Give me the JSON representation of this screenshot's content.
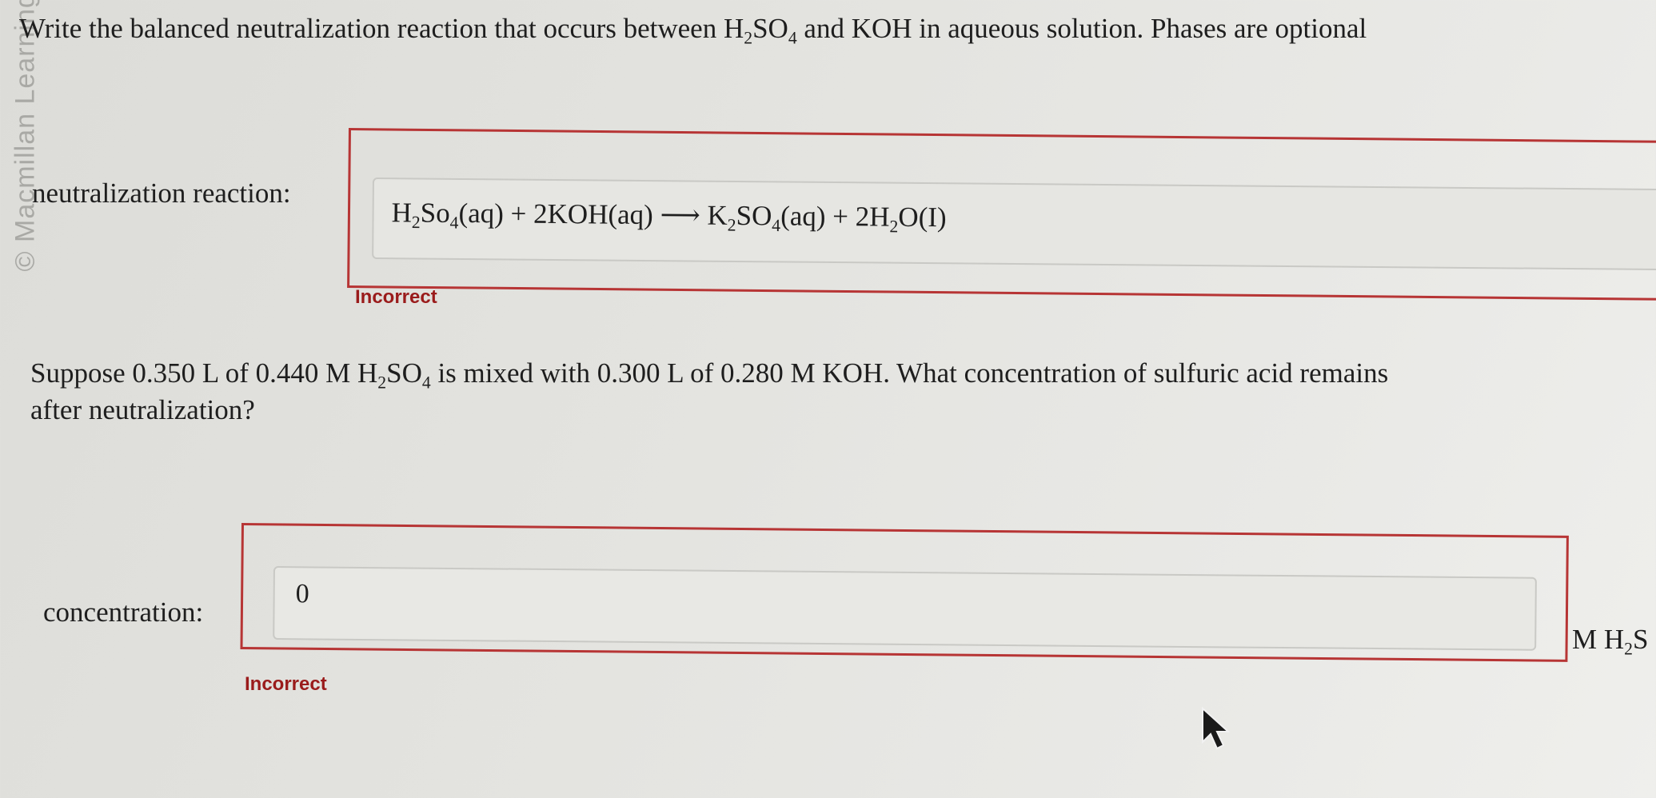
{
  "watermark": "© Macmillan Learning",
  "question1": {
    "text_before": "Write the balanced neutralization reaction that occurs between ",
    "acid_main": "H",
    "acid_sub1": "2",
    "acid_mid": "SO",
    "acid_sub2": "4",
    "text_after": " and KOH in aqueous solution. Phases are optional"
  },
  "reaction": {
    "label": "neutralization reaction:",
    "p1": "H",
    "s1": "2",
    "p2": "So",
    "s2": "4",
    "p3": "(aq) + 2KOH(aq) ⟶ K",
    "s3": "2",
    "p4": "SO",
    "s4": "4",
    "p5": "(aq) + 2H",
    "s5": "2",
    "p6": "O(I)",
    "feedback": "Incorrect"
  },
  "question2": {
    "line1_a": "Suppose 0.350 L of 0.440 M H",
    "line1_sub1": "2",
    "line1_b": "SO",
    "line1_sub2": "4",
    "line1_c": " is mixed with 0.300 L of 0.280 M KOH. What concentration of sulfuric acid remains",
    "line2": "after neutralization?"
  },
  "concentration": {
    "label": "concentration:",
    "value": "0",
    "unit_a": "M H",
    "unit_sub": "2",
    "unit_b": "S",
    "feedback": "Incorrect"
  }
}
